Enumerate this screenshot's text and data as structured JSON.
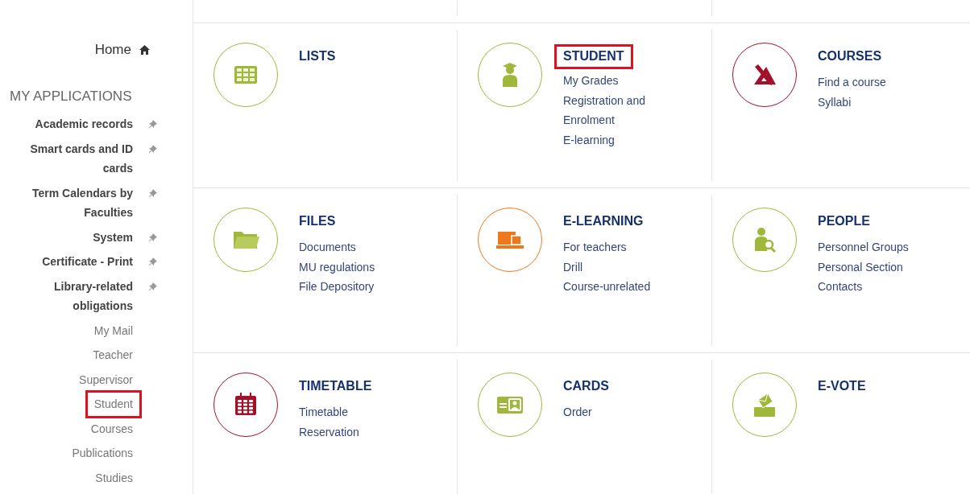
{
  "sidebar": {
    "home": {
      "label": "Home"
    },
    "section_title": "MY APPLICATIONS",
    "items": [
      {
        "label": "Academic records",
        "kind": "pinned",
        "highlighted": false
      },
      {
        "label": "Smart cards and ID cards",
        "kind": "pinned",
        "highlighted": false
      },
      {
        "label": "Term Calendars by Faculties",
        "kind": "pinned",
        "highlighted": false
      },
      {
        "label": "System",
        "kind": "pinned",
        "highlighted": false
      },
      {
        "label": "Certificate - Print",
        "kind": "pinned",
        "highlighted": false
      },
      {
        "label": "Library-related obligations",
        "kind": "pinned",
        "highlighted": false
      },
      {
        "label": "My Mail",
        "kind": "link",
        "highlighted": false
      },
      {
        "label": "Teacher",
        "kind": "link",
        "highlighted": false
      },
      {
        "label": "Supervisor",
        "kind": "link",
        "highlighted": false
      },
      {
        "label": "Student",
        "kind": "link",
        "highlighted": true
      },
      {
        "label": "Courses",
        "kind": "link",
        "highlighted": false
      },
      {
        "label": "Publications",
        "kind": "link",
        "highlighted": false
      },
      {
        "label": "Studies",
        "kind": "link",
        "highlighted": false
      }
    ]
  },
  "tiles": [
    {
      "title": "LISTS",
      "kind": "table",
      "color": "#9fb83a",
      "highlighted": false
    },
    {
      "title": "STUDENT",
      "kind": "student",
      "color": "#9fb83a",
      "highlighted": true,
      "links": [
        "My Grades",
        "Registration and Enrolment",
        "E-learning"
      ]
    },
    {
      "title": "COURSES",
      "kind": "courses",
      "color": "#a3102a",
      "highlighted": false,
      "links": [
        "Find a course",
        "Syllabi"
      ]
    },
    {
      "title": "FILES",
      "kind": "folder",
      "color": "#9fb83a",
      "highlighted": false,
      "links": [
        "Documents",
        "MU regulations",
        "File Depository"
      ]
    },
    {
      "title": "E-LEARNING",
      "kind": "elearning",
      "color": "#ec7a1c",
      "highlighted": false,
      "links": [
        "For teachers",
        "Drill",
        "Course-unrelated"
      ]
    },
    {
      "title": "PEOPLE",
      "kind": "person",
      "color": "#9fb83a",
      "highlighted": false,
      "links": [
        "Personnel Groups",
        "Personal Section",
        "Contacts"
      ]
    },
    {
      "title": "TIMETABLE",
      "kind": "calendar",
      "color": "#a3102a",
      "highlighted": false,
      "links": [
        "Timetable",
        "Reservation"
      ]
    },
    {
      "title": "CARDS",
      "kind": "card",
      "color": "#9fb83a",
      "highlighted": false,
      "links": [
        "Order"
      ]
    },
    {
      "title": "E-VOTE",
      "kind": "vote",
      "color": "#9fb83a",
      "highlighted": false
    }
  ]
}
